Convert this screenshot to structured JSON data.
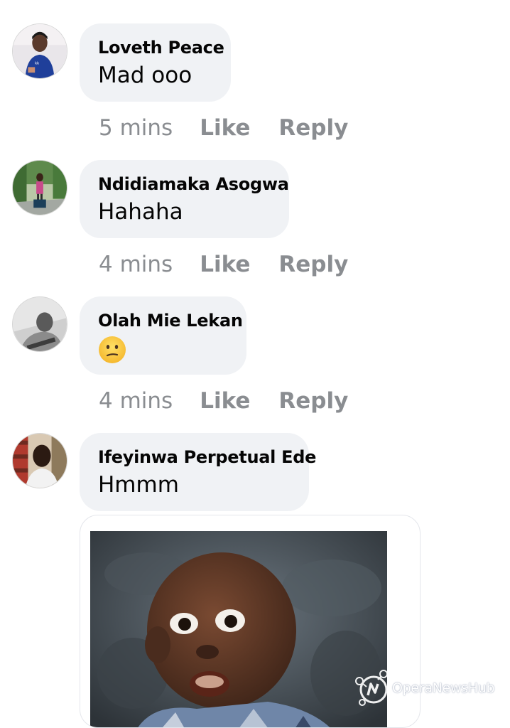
{
  "comments": [
    {
      "author": "Loveth Peace",
      "text": "Mad ooo",
      "time": "5 mins",
      "like_label": "Like",
      "reply_label": "Reply"
    },
    {
      "author": "Ndidiamaka Asogwa",
      "text": "Hahaha",
      "time": "4 mins",
      "like_label": "Like",
      "reply_label": "Reply"
    },
    {
      "author": "Olah Mie Lekan",
      "emoji": "confused-face-emoji",
      "time": "4 mins",
      "like_label": "Like",
      "reply_label": "Reply"
    },
    {
      "author": "Ifeyinwa Perpetual Ede",
      "text": "Hmmm",
      "attachment": "baby-photo-sticker"
    }
  ],
  "watermark": {
    "text": "OperaNewsHub",
    "icon": "operanews-logo-icon"
  },
  "colors": {
    "bubble": "#f0f2f5",
    "meta": "#8a8d91",
    "text": "#050505"
  }
}
